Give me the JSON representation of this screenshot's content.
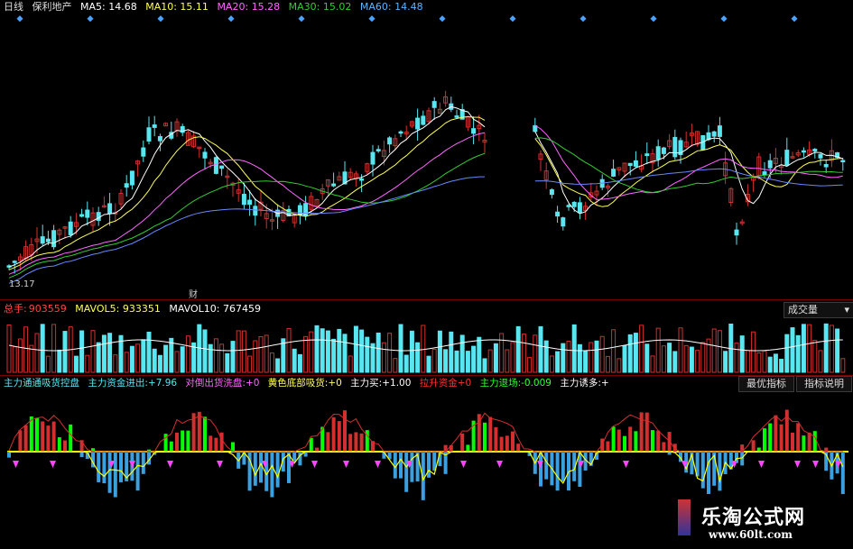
{
  "colors": {
    "bg": "#000000",
    "up": "#d32f2f",
    "down": "#58e6f0",
    "ma5": "#ffffff",
    "ma10": "#ffff55",
    "ma20": "#ff66ff",
    "ma30": "#33cc33",
    "ma60": "#6688ff",
    "grid": "#7a0000",
    "triangle": "#ff44ff",
    "yellow": "#ffff00",
    "green": "#00ff00"
  },
  "header": {
    "period": "日线",
    "stock_name": "保利地产",
    "ma5": "MA5: 14.68",
    "ma10": "MA10: 15.11",
    "ma20": "MA20: 15.28",
    "ma30": "MA30: 15.02",
    "ma60": "MA60: 14.48"
  },
  "price_panel": {
    "low_label": "13.17",
    "event_label": "财"
  },
  "volume_panel": {
    "total_label": "总手:",
    "total_value": "903559",
    "mavol5": "MAVOL5: 933351",
    "mavol10": "MAVOL10: 767459",
    "dropdown_label": "成交量"
  },
  "indicator_panel": {
    "name": "主力通通吸货控盘",
    "capital_label": "主力资金进出:",
    "capital_value": "+7.96",
    "wash_label": "对倒出货洗盘:",
    "wash_value": "+0",
    "yellow_label": "黄色底部吸货:",
    "yellow_value": "+0",
    "buy_label": "主力买:",
    "buy_value": "+1.00",
    "rise_label": "拉升资金",
    "rise_value": "+0",
    "exit_label": "主力退场:",
    "exit_value": "-0.009",
    "lure_label": "主力诱多:",
    "lure_value": "+",
    "btn_best": "最优指标",
    "btn_help": "指标说明"
  },
  "watermark": {
    "title": "乐淘公式网",
    "url": "www.60lt.com"
  }
}
